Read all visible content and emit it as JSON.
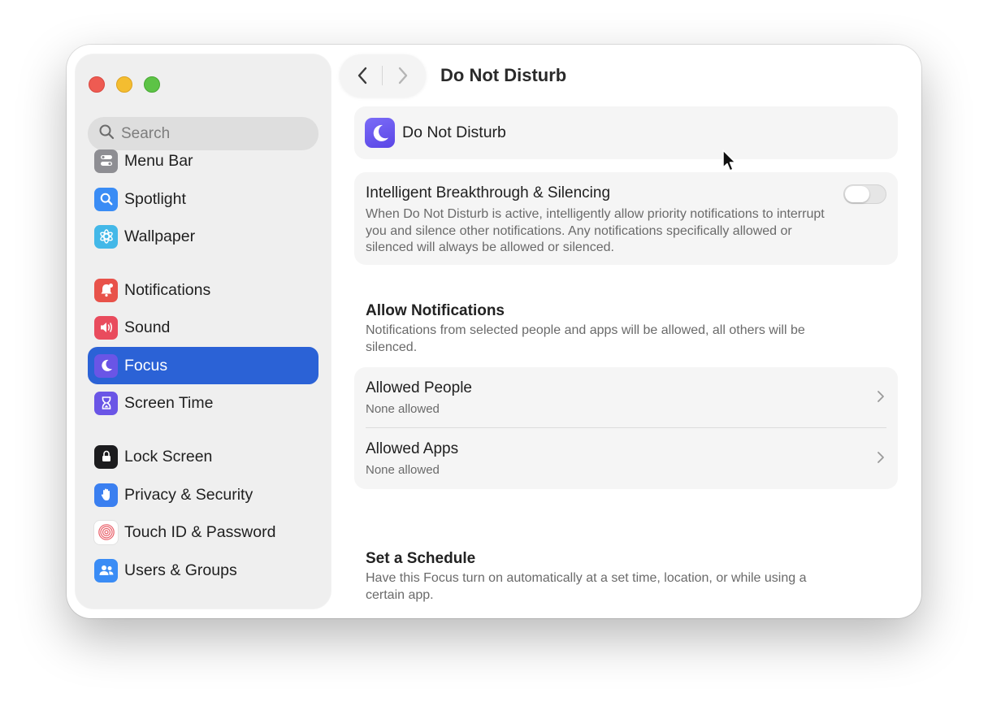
{
  "window": {
    "title": "Do Not Disturb"
  },
  "sidebar": {
    "search_placeholder": "Search",
    "items": [
      {
        "label": "Menu Bar",
        "icon": "menu-bar-icon",
        "color": "#8e8e93"
      },
      {
        "label": "Spotlight",
        "icon": "spotlight-icon",
        "color": "#3a8cf5"
      },
      {
        "label": "Wallpaper",
        "icon": "wallpaper-icon",
        "color": "#43b8e8"
      },
      {
        "label": "Notifications",
        "icon": "notifications-icon",
        "color": "#e8524a"
      },
      {
        "label": "Sound",
        "icon": "sound-icon",
        "color": "#e94b5d"
      },
      {
        "label": "Focus",
        "icon": "focus-icon",
        "color": "#6a55e6",
        "active": true
      },
      {
        "label": "Screen Time",
        "icon": "screen-time-icon",
        "color": "#6a55e6"
      },
      {
        "label": "Lock Screen",
        "icon": "lock-screen-icon",
        "color": "#1c1c1e"
      },
      {
        "label": "Privacy & Security",
        "icon": "privacy-icon",
        "color": "#3a7ff0"
      },
      {
        "label": "Touch ID & Password",
        "icon": "touch-id-icon",
        "color": "#ffffff"
      },
      {
        "label": "Users & Groups",
        "icon": "users-icon",
        "color": "#3a8cf5"
      }
    ]
  },
  "main": {
    "header_card": {
      "name": "Do Not Disturb",
      "icon": "moon-icon"
    },
    "intelligent": {
      "title": "Intelligent Breakthrough & Silencing",
      "description": "When Do Not Disturb is active, intelligently allow priority notifications to interrupt you and silence other notifications. Any notifications specifically allowed or silenced will always be allowed or silenced.",
      "enabled": false
    },
    "allow_notifications": {
      "title": "Allow Notifications",
      "description": "Notifications from selected people and apps will be allowed, all others will be silenced.",
      "rows": [
        {
          "title": "Allowed People",
          "subtitle": "None allowed"
        },
        {
          "title": "Allowed Apps",
          "subtitle": "None allowed"
        }
      ]
    },
    "schedule": {
      "title": "Set a Schedule",
      "description": "Have this Focus turn on automatically at a set time, location, or while using a certain app."
    }
  },
  "colors": {
    "accent": "#2b62d6",
    "focus_purple": "#6a55e6"
  }
}
